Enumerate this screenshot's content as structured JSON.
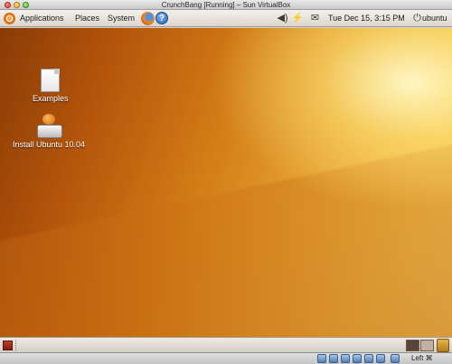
{
  "window": {
    "title": "CrunchBang [Running] – Sun VirtualBox"
  },
  "top_panel": {
    "menus": [
      "Applications",
      "Places",
      "System"
    ],
    "help_glyph": "?",
    "clock": "Tue Dec 15,  3:15 PM",
    "user": "ubuntu",
    "icons": [
      "ubuntu-logo-icon",
      "firefox-icon",
      "help-icon",
      "volume-icon",
      "network-icon",
      "mail-icon",
      "power-icon"
    ]
  },
  "desktop": {
    "icons": [
      {
        "label": "Examples",
        "icon": "folder-document-icon"
      },
      {
        "label": "Install Ubuntu 10.04",
        "icon": "installer-icon"
      }
    ]
  },
  "bottom_panel": {
    "icons": [
      "show-desktop-icon",
      "workspace-switcher",
      "trash-icon"
    ]
  },
  "vbox_status": {
    "host_key": "Left ⌘",
    "icons": [
      "hard-disk-icon",
      "cd-icon",
      "floppy-icon",
      "network-adapter-icon",
      "usb-icon",
      "shared-folder-icon",
      "mouse-integration-icon"
    ]
  },
  "colors": {
    "panel": "#e8e3dc",
    "desktop_accent": "#d27c17"
  }
}
